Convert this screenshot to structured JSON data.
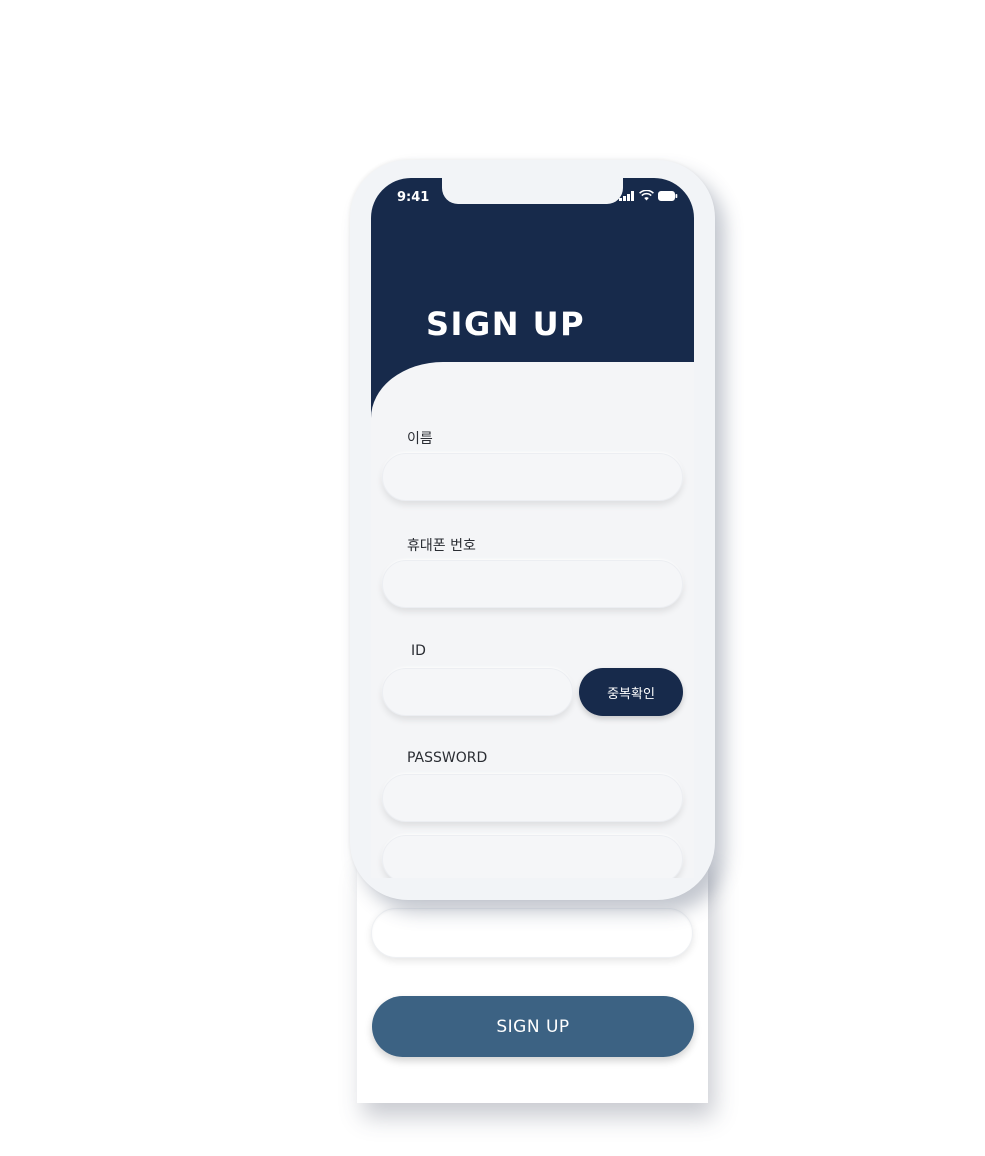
{
  "status_bar": {
    "time": "9:41",
    "icons": [
      "cellular-signal-icon",
      "wifi-icon",
      "battery-icon"
    ]
  },
  "header": {
    "title": "SIGN UP"
  },
  "form": {
    "name_label": "이름",
    "phone_label": "휴대폰 번호",
    "id_label": "ID",
    "password_label": "PASSWORD",
    "duplicate_check_label": "중복확인",
    "submit_label": "SIGN UP"
  },
  "colors": {
    "header_navy": "#172a4b",
    "submit_blue": "#3c6283",
    "field_bg": "#f5f6f8"
  }
}
